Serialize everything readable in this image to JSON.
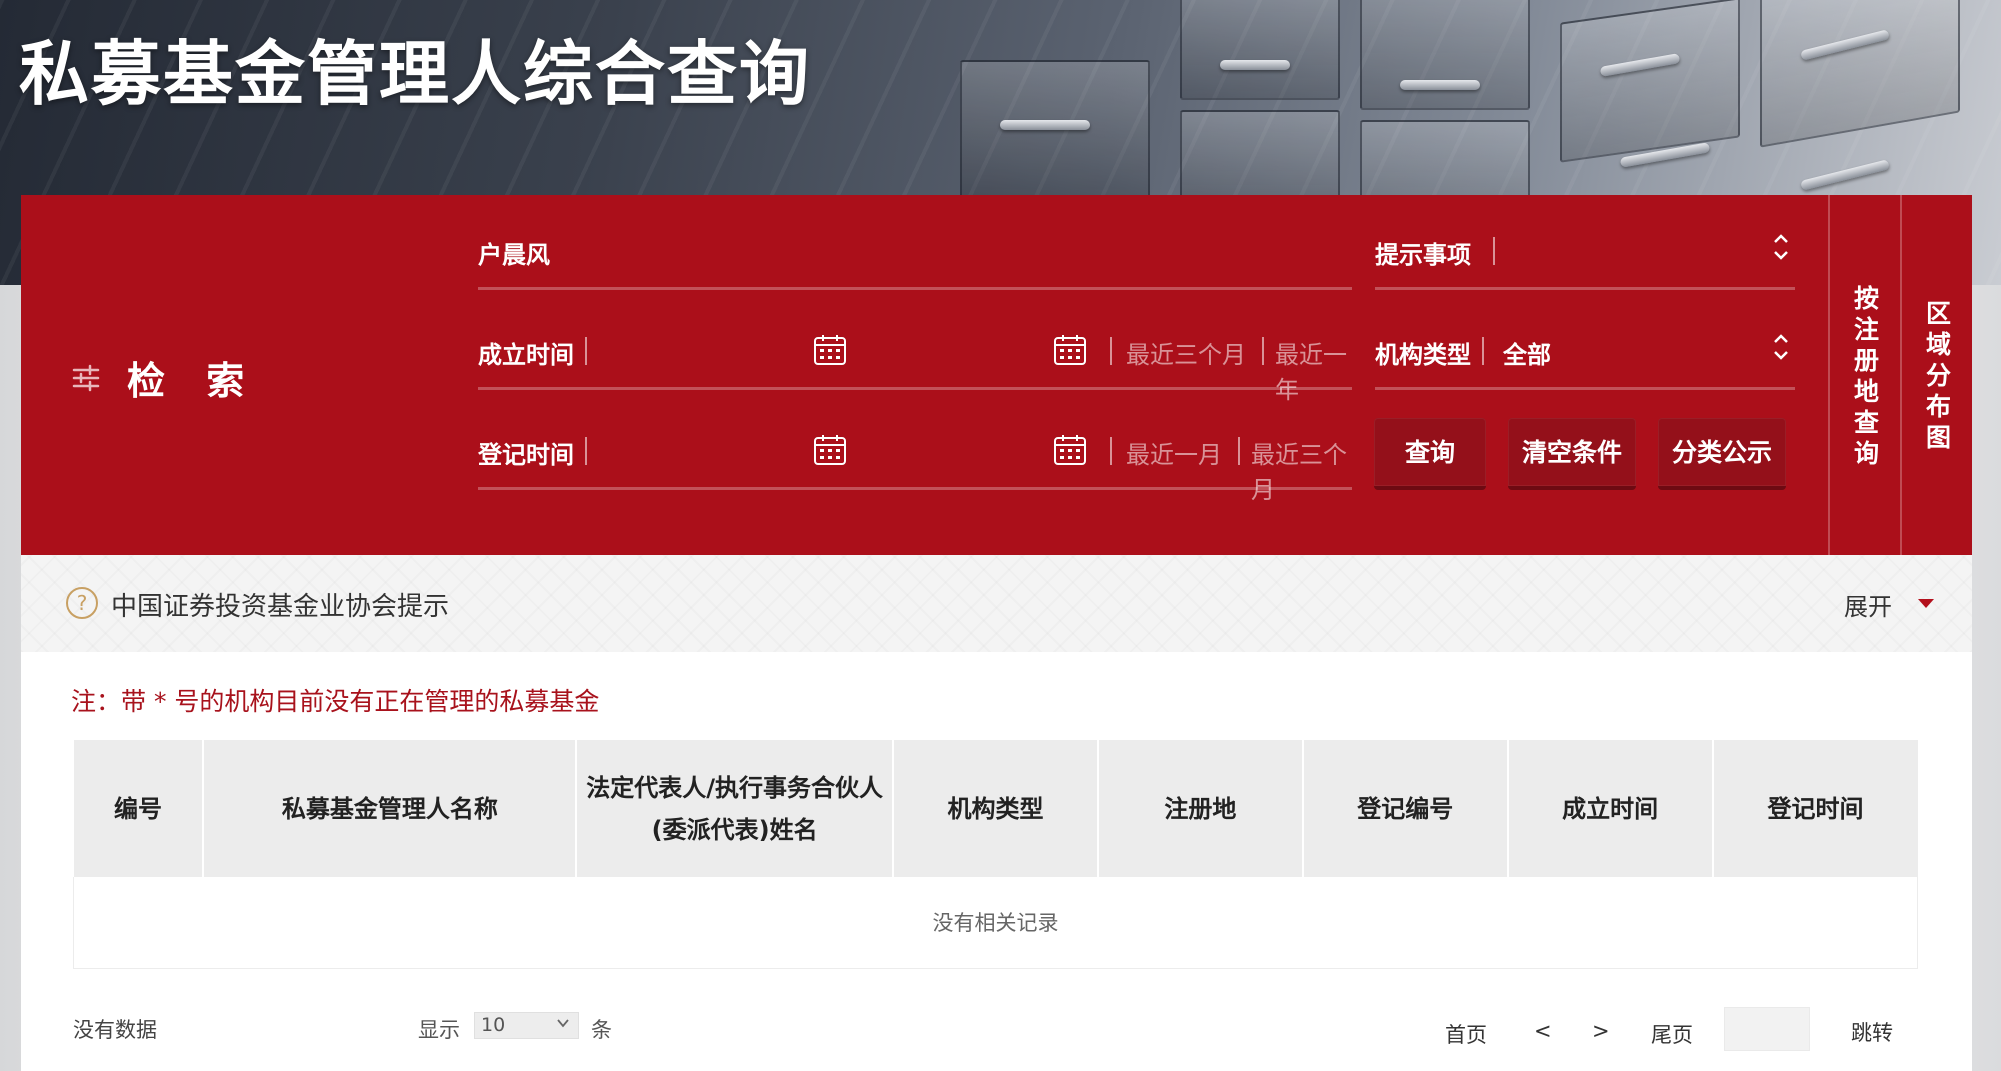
{
  "page": {
    "title": "私募基金管理人综合查询"
  },
  "search": {
    "label": "检 索",
    "keyword_value": "户晨风",
    "hint": {
      "label": "提示事项",
      "value": ""
    },
    "established_time": {
      "label": "成立时间",
      "quick": [
        "最近三个月",
        "最近一年"
      ]
    },
    "org_type": {
      "label": "机构类型",
      "value": "全部"
    },
    "registered_time": {
      "label": "登记时间",
      "quick": [
        "最近一月",
        "最近三个月"
      ]
    },
    "buttons": {
      "query": "查询",
      "clear": "清空条件",
      "category": "分类公示"
    },
    "side_tabs": [
      "按注册地查询",
      "区域分布图"
    ]
  },
  "notice": {
    "text": "中国证券投资基金业协会提示",
    "expand_label": "展开"
  },
  "note": "注：带 * 号的机构目前没有正在管理的私募基金",
  "table": {
    "columns": [
      "编号",
      "私募基金管理人名称",
      "法定代表人/执行事务合伙人(委派代表)姓名",
      "机构类型",
      "注册地",
      "登记编号",
      "成立时间",
      "登记时间"
    ],
    "empty_text": "没有相关记录"
  },
  "footer": {
    "no_data": "没有数据",
    "show_label": "显示",
    "page_size": "10",
    "unit": "条",
    "first": "首页",
    "prev": "<",
    "next": ">",
    "last": "尾页",
    "jump": "跳转"
  },
  "colors": {
    "brand_red": "#ab0f1a",
    "button_red": "#94101a",
    "note_red": "#a8121c",
    "header_gray": "#ececec"
  }
}
